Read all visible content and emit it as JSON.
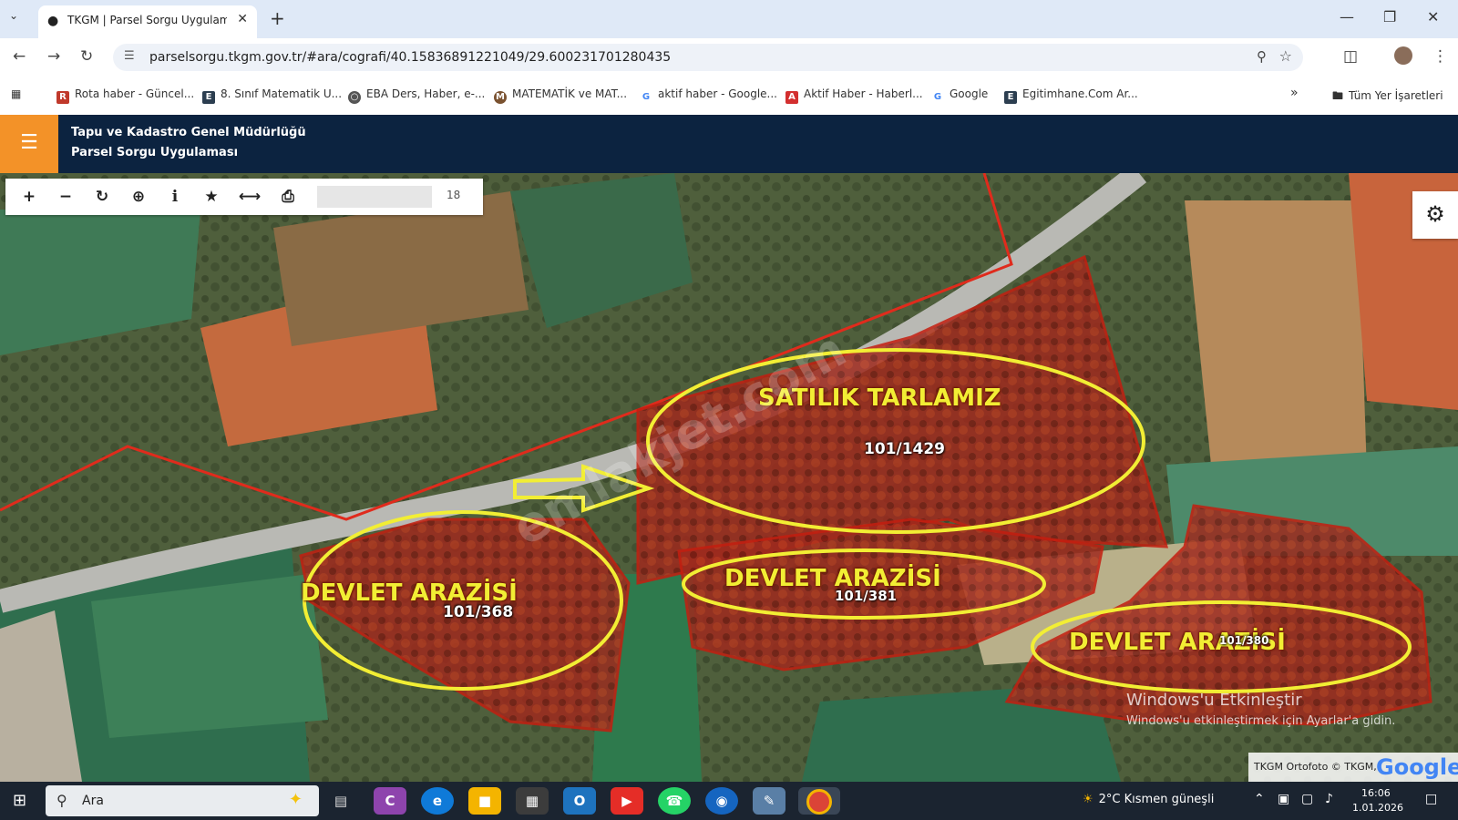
{
  "browser": {
    "tab_title": "TKGM | Parsel Sorgu Uygulaması",
    "url": "parselsorgu.tkgm.gov.tr/#ara/cografi/40.15836891221049/29.600231701280435",
    "bookmarks": [
      {
        "label": "Rota haber - Güncel...",
        "icon": "rh-icon",
        "color": "#c0392b"
      },
      {
        "label": "8. Sınıf Matematik U...",
        "icon": "e-icon",
        "color": "#2c3e50"
      },
      {
        "label": "EBA Ders, Haber, e-...",
        "icon": "globe-icon",
        "color": "#555555"
      },
      {
        "label": "MATEMATİK ve MAT...",
        "icon": "math-icon",
        "color": "#7a5230"
      },
      {
        "label": "aktif haber - Google...",
        "icon": "google-icon",
        "color": "#4285f4"
      },
      {
        "label": "Aktif Haber - Haberl...",
        "icon": "aktif-icon",
        "color": "#d32f2f"
      },
      {
        "label": "Google",
        "icon": "google-icon",
        "color": "#4285f4"
      },
      {
        "label": "Egitimhane.Com Ar...",
        "icon": "e-icon",
        "color": "#2c3e50"
      }
    ],
    "all_bookmarks": "Tüm Yer İşaretleri",
    "overflow": "»"
  },
  "app": {
    "org_name": "Tapu ve Kadastro Genel Müdürlüğü",
    "app_name": "Parsel Sorgu Uygulaması",
    "zoom_level": "18"
  },
  "map": {
    "labels": {
      "for_sale": "SATILIK TARLAMIZ",
      "state_land": "DEVLET ARAZİSİ"
    },
    "parcels": {
      "main": "101/1429",
      "left": "101/368",
      "middle": "101/381",
      "right": "101/380"
    },
    "watermark": "emlakjet.com",
    "activation_title": "Windows'u Etkinleştir",
    "activation_sub": "Windows'u etkinleştirmek için Ayarlar'a gidin.",
    "attribution": "TKGM Ortofoto © TKGM,",
    "google": "Google"
  },
  "taskbar": {
    "search_placeholder": "Ara",
    "weather": "2°C  Kısmen güneşli",
    "time": "16:06",
    "date": "1.01.2026"
  },
  "colors": {
    "header_bg": "#0c2340",
    "menu_accent": "#f39228",
    "parcel_fill": "#c0392b",
    "highlight": "#f2ee34"
  }
}
